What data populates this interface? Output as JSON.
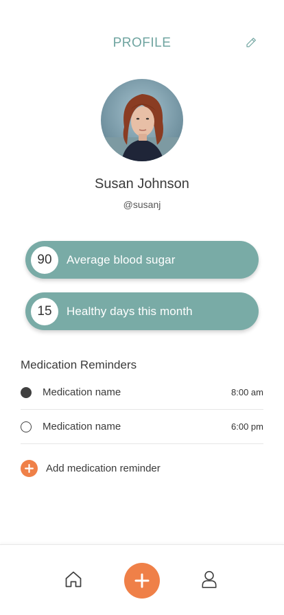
{
  "header": {
    "title": "PROFILE",
    "edit_icon": "pencil-icon"
  },
  "profile": {
    "name": "Susan Johnson",
    "handle": "@susanj"
  },
  "stats": [
    {
      "value": "90",
      "label": "Average blood sugar"
    },
    {
      "value": "15",
      "label": "Healthy days this month"
    }
  ],
  "reminders": {
    "title": "Medication Reminders",
    "items": [
      {
        "name": "Medication name",
        "time": "8:00 am",
        "status": "filled"
      },
      {
        "name": "Medication name",
        "time": "6:00 pm",
        "status": "empty"
      }
    ],
    "add_label": "Add medication reminder"
  },
  "nav": {
    "items": [
      "home-icon",
      "add-icon",
      "user-icon"
    ]
  },
  "colors": {
    "accent_teal": "#79aba6",
    "title_teal": "#6fa4a0",
    "accent_orange": "#ef8048"
  }
}
